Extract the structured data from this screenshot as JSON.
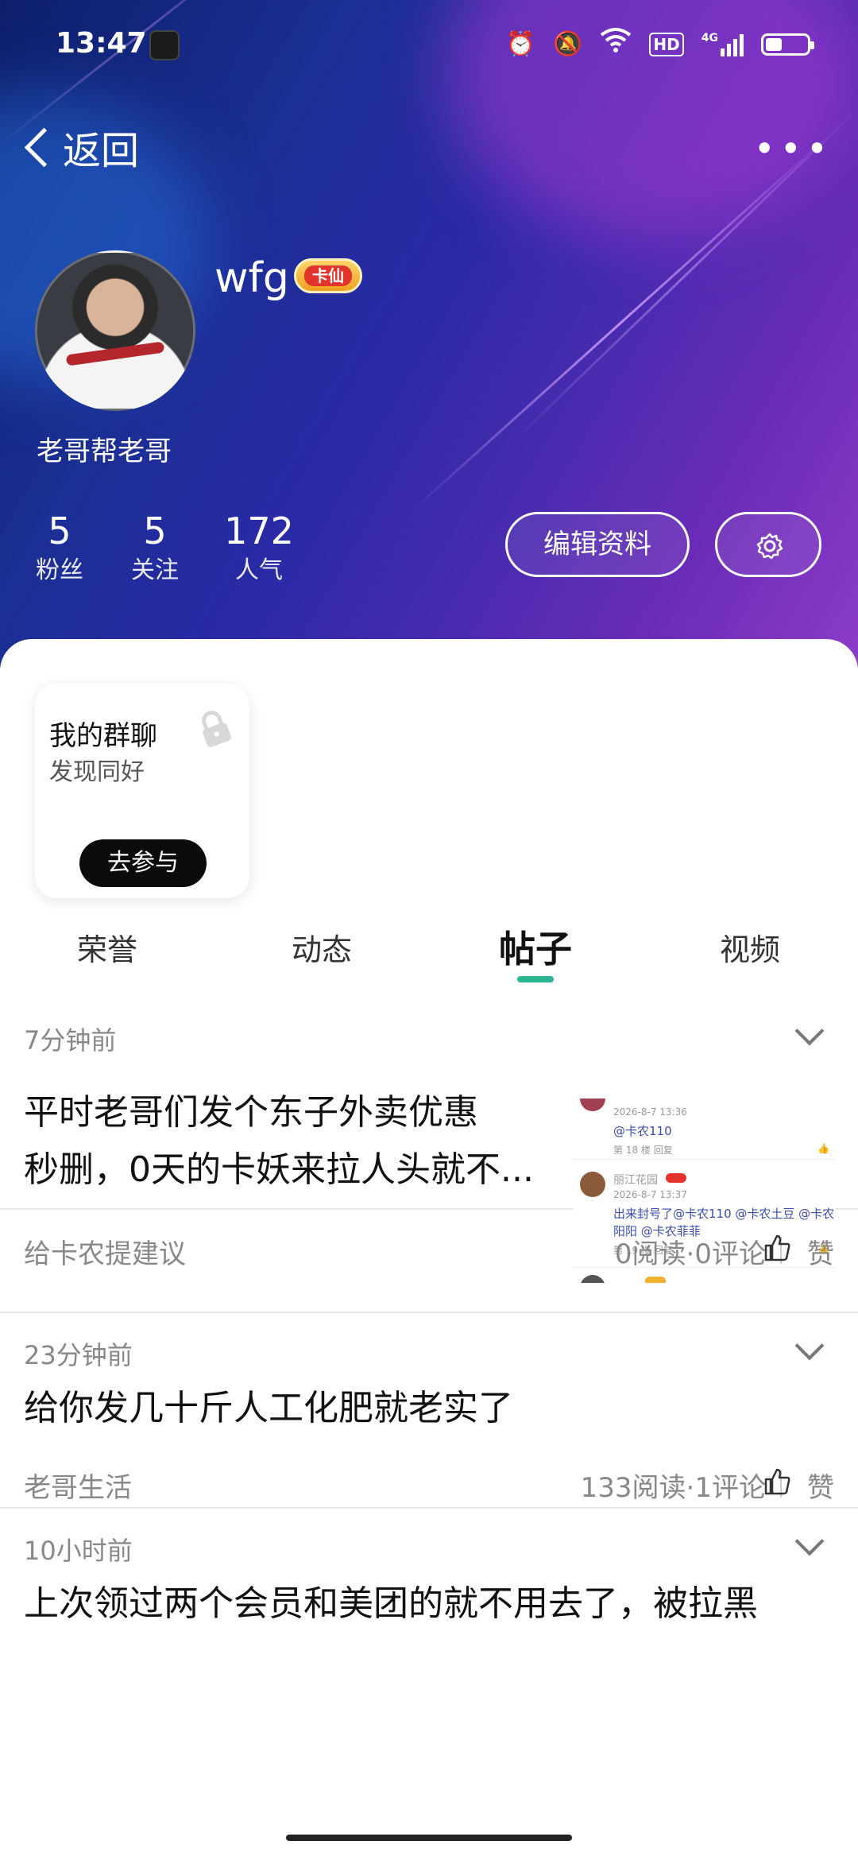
{
  "status_bar": {
    "time": "13:47",
    "icons": [
      "alarm-icon",
      "mute-icon",
      "wifi-icon",
      "hd-icon",
      "4g-signal-icon",
      "battery-icon"
    ],
    "hd_label": "HD",
    "network_label": "4G"
  },
  "nav": {
    "back_label": "返回",
    "more_label": "•••"
  },
  "profile": {
    "username": "wfg",
    "badge_label": "卡仙",
    "bio": "老哥帮老哥",
    "stats": [
      {
        "value": "5",
        "label": "粉丝"
      },
      {
        "value": "5",
        "label": "关注"
      },
      {
        "value": "172",
        "label": "人气"
      }
    ],
    "edit_button": "编辑资料"
  },
  "group_card": {
    "title": "我的群聊",
    "subtitle": "发现同好",
    "join_button": "去参与"
  },
  "tabs": [
    {
      "label": "荣誉",
      "active": false
    },
    {
      "label": "动态",
      "active": false
    },
    {
      "label": "帖子",
      "active": true
    },
    {
      "label": "视频",
      "active": false
    }
  ],
  "accent_color": "#2db596",
  "posts": [
    {
      "time": "7分钟前",
      "title_lines": [
        "平时老哥们发个东子外卖优惠",
        "秒删，0天的卡妖来拉人头就不..."
      ],
      "category": "给卡农提建议",
      "stats": "0阅读·0评论",
      "like_label": "赞",
      "thumbnail": {
        "rows": [
          {
            "time": "2026-8-7 13:36",
            "text": "@卡农110",
            "floor": "第 18 楼  回复"
          },
          {
            "name": "丽江花园",
            "time": "2026-8-7 13:37",
            "text": "出来封号了@卡农110 @卡农土豆 @卡农",
            "text2": "阳阳 @卡农菲菲",
            "floor": "第 19 楼  回复"
          }
        ]
      }
    },
    {
      "time": "23分钟前",
      "title_lines": [
        "给你发几十斤人工化肥就老实了"
      ],
      "category": "老哥生活",
      "stats": "133阅读·1评论",
      "like_label": "赞"
    },
    {
      "time": "10小时前",
      "title_lines": [
        "上次领过两个会员和美团的就不用去了，被拉黑"
      ],
      "category": "",
      "stats": "",
      "like_label": ""
    }
  ]
}
